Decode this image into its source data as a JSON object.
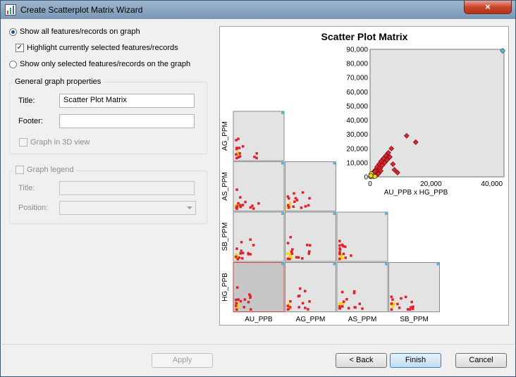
{
  "window": {
    "title": "Create Scatterplot Matrix Wizard",
    "close_glyph": "×"
  },
  "options": {
    "show_all": "Show all features/records on graph",
    "highlight_selected": "Highlight currently selected features/records",
    "show_only_selected": "Show only selected features/records on the graph"
  },
  "general": {
    "header": "General graph properties",
    "title_label": "Title:",
    "title_value": "Scatter Plot Matrix",
    "footer_label": "Footer:",
    "footer_value": "",
    "graph_3d_label": "Graph in 3D view"
  },
  "legend": {
    "header": "Graph legend",
    "title_label": "Title:",
    "position_label": "Position:"
  },
  "buttons": {
    "apply": "Apply",
    "back": "< Back",
    "finish": "Finish",
    "cancel": "Cancel"
  },
  "chart_data": {
    "type": "scatter",
    "title": "Scatter Plot Matrix",
    "variables": [
      "AU_PPB",
      "AG_PPM",
      "AS_PPM",
      "SB_PPM",
      "HG_PPB"
    ],
    "column_labels": [
      "AU_PPB",
      "AG_PPM",
      "AS_PPM",
      "SB_PPM"
    ],
    "row_labels": [
      "AG_PPM",
      "AS_PPM",
      "SB_PPM",
      "HG_PPB"
    ],
    "selected_cell": {
      "row": "HG_PPB",
      "col": "AU_PPB"
    },
    "colors": {
      "point": "#e0202a",
      "highlight": "#f2d41c",
      "cell_bg": "#e3e3e3",
      "selected_bg": "#c7c7c7",
      "handle": "#57b6cf"
    },
    "enlarged": {
      "caption": "AU_PPB x HG_PPB",
      "xlim": [
        0,
        44000
      ],
      "ylim": [
        0,
        90000
      ],
      "xticks": [
        "0",
        "20,000",
        "40,000"
      ],
      "yticks": [
        "0",
        "10,000",
        "20,000",
        "30,000",
        "40,000",
        "50,000",
        "60,000",
        "70,000",
        "80,000",
        "90,000"
      ],
      "points": [
        [
          200,
          300
        ],
        [
          400,
          800
        ],
        [
          600,
          1500
        ],
        [
          800,
          900
        ],
        [
          1000,
          2000
        ],
        [
          1200,
          3500
        ],
        [
          1500,
          1200
        ],
        [
          1800,
          5000
        ],
        [
          2000,
          2500
        ],
        [
          2300,
          7000
        ],
        [
          2600,
          4000
        ],
        [
          3000,
          9000
        ],
        [
          3300,
          6000
        ],
        [
          3600,
          11000
        ],
        [
          4000,
          8000
        ],
        [
          4400,
          13000
        ],
        [
          4800,
          10000
        ],
        [
          5200,
          15000
        ],
        [
          5600,
          12000
        ],
        [
          6000,
          17000
        ],
        [
          6500,
          14000
        ],
        [
          7000,
          20000
        ],
        [
          7500,
          9000
        ],
        [
          8000,
          5000
        ],
        [
          9000,
          3000
        ],
        [
          12000,
          29000
        ],
        [
          15000,
          24500
        ],
        [
          300,
          1800
        ],
        [
          700,
          2600
        ],
        [
          1100,
          600
        ],
        [
          1600,
          3800
        ],
        [
          2100,
          1000
        ],
        [
          2700,
          2200
        ],
        [
          3500,
          4200
        ]
      ],
      "highlight_points": [
        [
          150,
          200
        ],
        [
          350,
          500
        ],
        [
          500,
          1100
        ],
        [
          700,
          400
        ],
        [
          900,
          1400
        ],
        [
          1100,
          250
        ],
        [
          1300,
          800
        ],
        [
          1600,
          300
        ],
        [
          450,
          2200
        ],
        [
          250,
          900
        ]
      ],
      "corner_point": [
        44000,
        90000
      ]
    }
  }
}
